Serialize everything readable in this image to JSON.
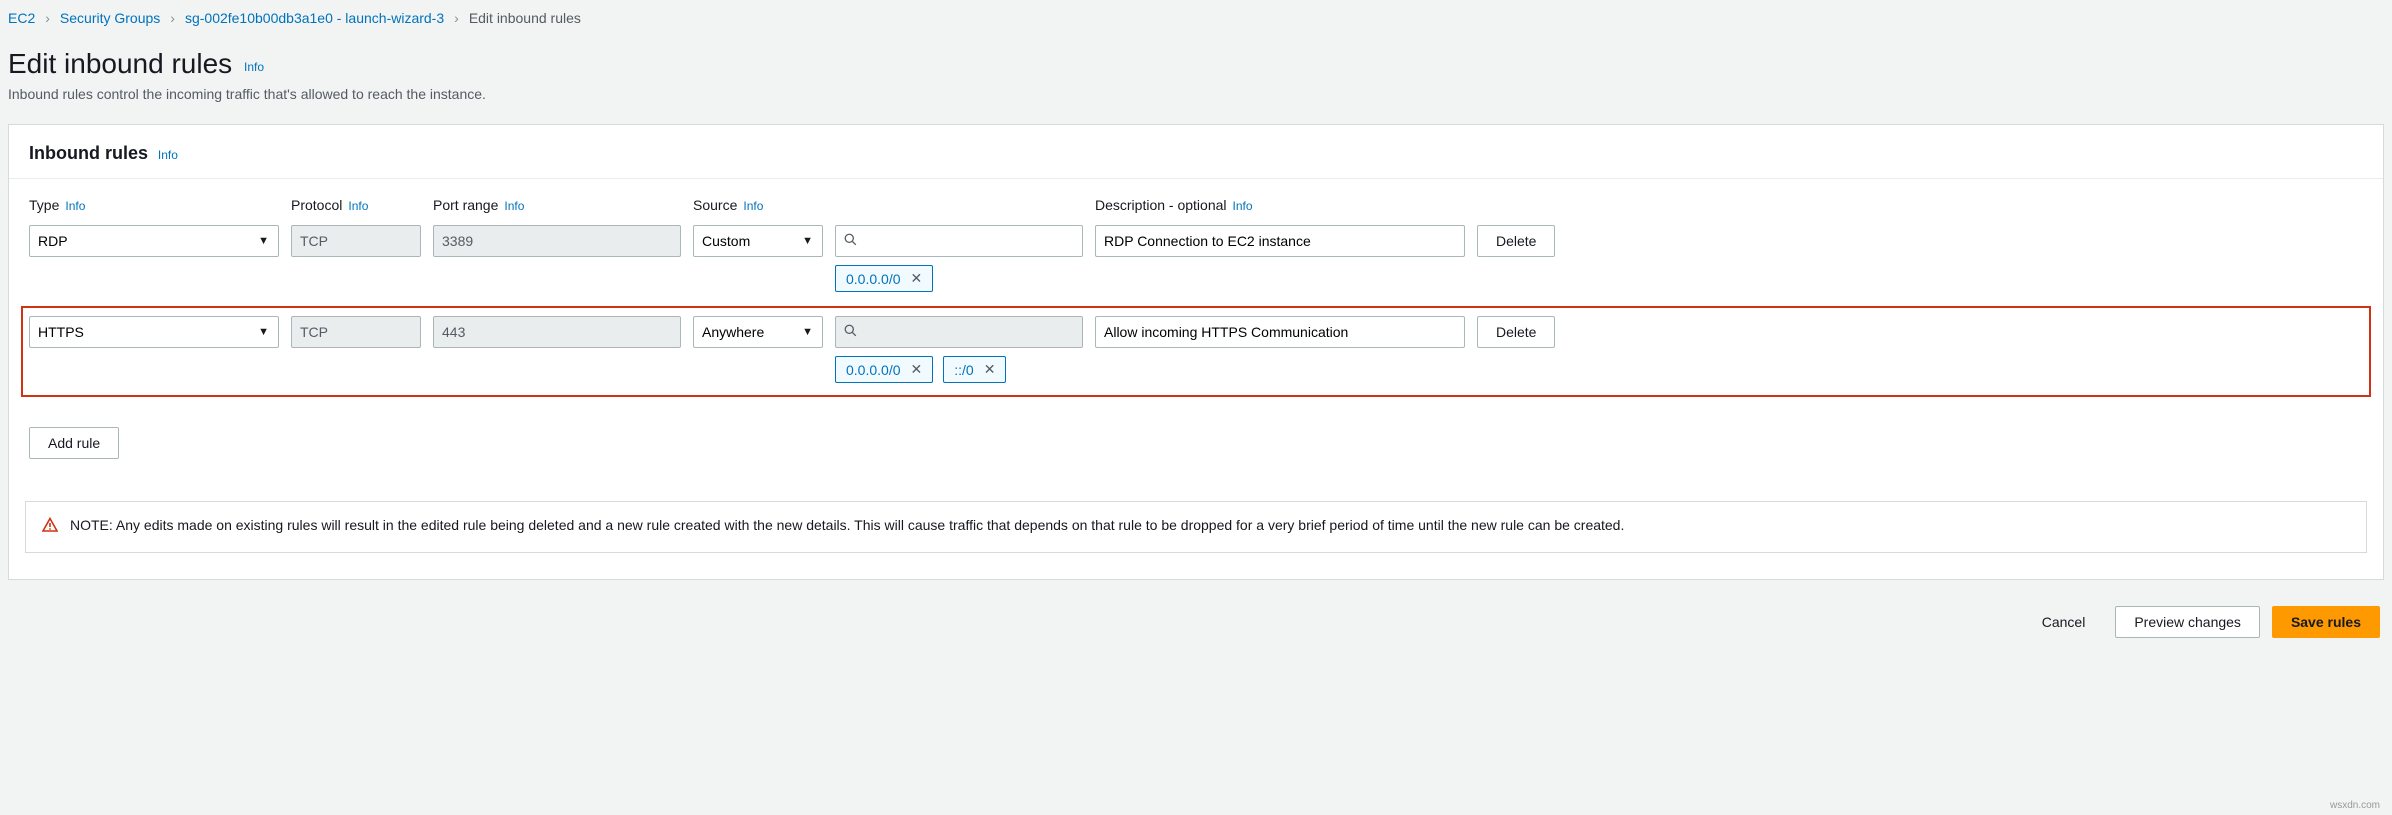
{
  "breadcrumb": {
    "items": [
      "EC2",
      "Security Groups",
      "sg-002fe10b00db3a1e0 - launch-wizard-3"
    ],
    "current": "Edit inbound rules"
  },
  "title": "Edit inbound rules",
  "title_info": "Info",
  "subtitle": "Inbound rules control the incoming traffic that's allowed to reach the instance.",
  "panel": {
    "heading": "Inbound rules",
    "heading_info": "Info"
  },
  "columns": {
    "type": "Type",
    "protocol": "Protocol",
    "port_range": "Port range",
    "source": "Source",
    "description": "Description - optional"
  },
  "info_label": "Info",
  "rules": [
    {
      "type": "RDP",
      "protocol": "TCP",
      "port_range": "3389",
      "source_mode": "Custom",
      "source_search_disabled": false,
      "chips": [
        "0.0.0.0/0"
      ],
      "description": "RDP Connection to EC2 instance",
      "highlight": false
    },
    {
      "type": "HTTPS",
      "protocol": "TCP",
      "port_range": "443",
      "source_mode": "Anywhere",
      "source_search_disabled": true,
      "chips": [
        "0.0.0.0/0",
        "::/0"
      ],
      "description": "Allow incoming HTTPS Communication",
      "highlight": true
    }
  ],
  "buttons": {
    "delete": "Delete",
    "add_rule": "Add rule",
    "cancel": "Cancel",
    "preview": "Preview changes",
    "save": "Save rules"
  },
  "note": "NOTE: Any edits made on existing rules will result in the edited rule being deleted and a new rule created with the new details. This will cause traffic that depends on that rule to be dropped for a very brief period of time until the new rule can be created.",
  "watermark": "wsxdn.com"
}
